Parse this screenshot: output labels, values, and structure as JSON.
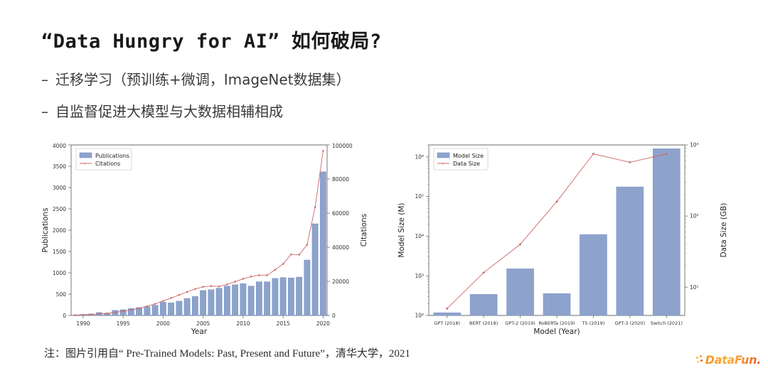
{
  "slide": {
    "title": "“Data Hungry for AI” 如何破局?",
    "bullets": [
      "迁移学习（预训练+微调，ImageNet数据集）",
      "自监督促进大模型与大数据相辅相成"
    ],
    "footnote": "注：图片引用自“ Pre-Trained Models: Past, Present and Future”，清华大学，2021",
    "logo_text": "DataFun."
  },
  "colors": {
    "bar": "#8da3cc",
    "bar_edge": "#7890c2",
    "line": "#cd6767",
    "axis": "#6b6b6b",
    "text": "#303030",
    "logo_orange": "#f7941e",
    "logo_red": "#f15a24"
  },
  "chart_data": [
    {
      "type": "bar",
      "id": "publications-citations",
      "title": "",
      "xlabel": "Year",
      "ylabel": "Publications",
      "y2label": "Citations",
      "ylim": [
        0,
        4000
      ],
      "y2lim": [
        0,
        100000
      ],
      "yticks": [
        0,
        500,
        1000,
        1500,
        2000,
        2500,
        3000,
        3500,
        4000
      ],
      "y2ticks": [
        0,
        20000,
        40000,
        60000,
        80000,
        100000
      ],
      "xticks": [
        1990,
        1995,
        2000,
        2005,
        2010,
        2015,
        2020
      ],
      "grid": false,
      "legend_position": "upper left",
      "categories": [
        1989,
        1990,
        1991,
        1992,
        1993,
        1994,
        1995,
        1996,
        1997,
        1998,
        1999,
        2000,
        2001,
        2002,
        2003,
        2004,
        2005,
        2006,
        2007,
        2008,
        2009,
        2010,
        2011,
        2012,
        2013,
        2014,
        2015,
        2016,
        2017,
        2018,
        2019,
        2020
      ],
      "series": [
        {
          "name": "Publications",
          "kind": "bar",
          "axis": "left",
          "values": [
            10,
            25,
            35,
            70,
            55,
            120,
            135,
            165,
            185,
            205,
            240,
            310,
            295,
            335,
            400,
            445,
            585,
            605,
            640,
            690,
            720,
            745,
            690,
            790,
            790,
            870,
            890,
            880,
            900,
            1300,
            2150,
            3370
          ]
        },
        {
          "name": "Citations",
          "kind": "line",
          "axis": "right",
          "values": [
            200,
            400,
            600,
            900,
            1200,
            1800,
            2500,
            3200,
            4200,
            5400,
            6800,
            8500,
            10200,
            12000,
            13800,
            15500,
            16800,
            17200,
            17000,
            18200,
            19800,
            21500,
            22800,
            23600,
            23600,
            26800,
            30200,
            35800,
            35600,
            41500,
            63500,
            96500
          ]
        }
      ]
    },
    {
      "type": "bar",
      "id": "model-size-data-size",
      "title": "",
      "xlabel": "Model (Year)",
      "ylabel": "Model Size (M)",
      "y2label": "Data Size (GB)",
      "yscale": "log",
      "y2scale": "log",
      "ylim": [
        100,
        2000000
      ],
      "y2lim": [
        4,
        1000
      ],
      "yticks": [
        "10²",
        "10³",
        "10⁴",
        "10⁵",
        "10⁶"
      ],
      "y2ticks": [
        "10¹",
        "10²",
        "10³"
      ],
      "grid": false,
      "legend_position": "upper left",
      "categories": [
        "GPT (2018)",
        "BERT (2018)",
        "GPT-2 (2019)",
        "RoBERTa (2019)",
        "T5 (2019)",
        "GPT-3 (2020)",
        "Switch (2021)"
      ],
      "series": [
        {
          "name": "Model Size",
          "kind": "bar",
          "axis": "left",
          "unit": "M",
          "values": [
            117,
            340,
            1500,
            355,
            11000,
            175000,
            1600000
          ]
        },
        {
          "name": "Data Size",
          "kind": "line",
          "axis": "right",
          "unit": "GB",
          "values": [
            5,
            16,
            40,
            160,
            750,
            570,
            750
          ]
        }
      ]
    }
  ]
}
